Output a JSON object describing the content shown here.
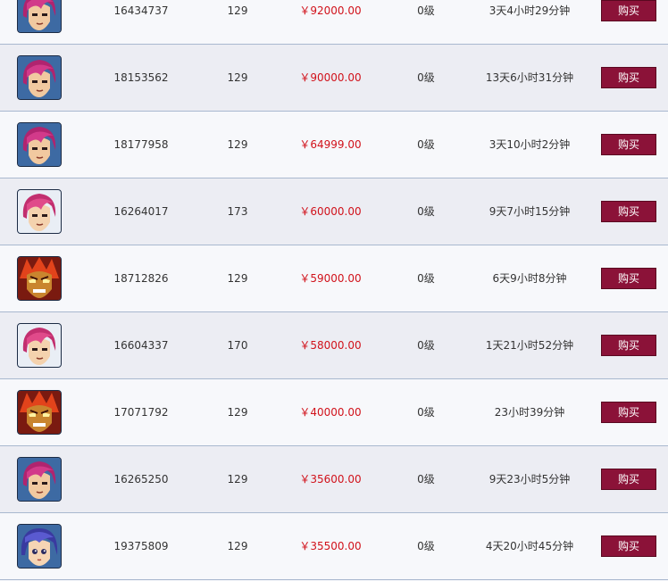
{
  "buy_label": "购买",
  "colors": {
    "price": "#d1121b",
    "buy_button": "#8b1238",
    "row_light": "#f7f8fb",
    "row_dark": "#ecedf3",
    "divider": "#a9b8cf"
  },
  "listings": [
    {
      "avatar": "pink-hair-swordsman-icon",
      "id": "16434737",
      "level": "129",
      "price": "￥92000.00",
      "grade": "0级",
      "time_left": "3天4小时29分钟"
    },
    {
      "avatar": "pink-hair-swordsman-icon",
      "id": "18153562",
      "level": "129",
      "price": "￥90000.00",
      "grade": "0级",
      "time_left": "13天6小时31分钟"
    },
    {
      "avatar": "pink-hair-swordsman-icon",
      "id": "18177958",
      "level": "129",
      "price": "￥64999.00",
      "grade": "0级",
      "time_left": "3天10小时2分钟"
    },
    {
      "avatar": "pink-hair-swordsman-light-icon",
      "id": "16264017",
      "level": "173",
      "price": "￥60000.00",
      "grade": "0级",
      "time_left": "9天7小时15分钟"
    },
    {
      "avatar": "red-demon-icon",
      "id": "18712826",
      "level": "129",
      "price": "￥59000.00",
      "grade": "0级",
      "time_left": "6天9小时8分钟"
    },
    {
      "avatar": "pink-hair-swordsman-light-icon",
      "id": "16604337",
      "level": "170",
      "price": "￥58000.00",
      "grade": "0级",
      "time_left": "1天21小时52分钟"
    },
    {
      "avatar": "red-demon-icon",
      "id": "17071792",
      "level": "129",
      "price": "￥40000.00",
      "grade": "0级",
      "time_left": "23小时39分钟"
    },
    {
      "avatar": "pink-hair-swordsman-icon",
      "id": "16265250",
      "level": "129",
      "price": "￥35600.00",
      "grade": "0级",
      "time_left": "9天23小时5分钟"
    },
    {
      "avatar": "blue-hair-girl-icon",
      "id": "19375809",
      "level": "129",
      "price": "￥35500.00",
      "grade": "0级",
      "time_left": "4天20小时45分钟"
    }
  ]
}
